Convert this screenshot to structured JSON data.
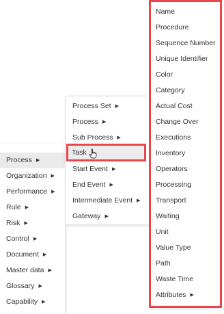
{
  "left_menu": {
    "items": [
      {
        "label": "Process",
        "has_submenu": true,
        "active": true
      },
      {
        "label": "Organization",
        "has_submenu": true
      },
      {
        "label": "Performance",
        "has_submenu": true
      },
      {
        "label": "Rule",
        "has_submenu": true
      },
      {
        "label": "Risk",
        "has_submenu": true
      },
      {
        "label": "Control",
        "has_submenu": true
      },
      {
        "label": "Document",
        "has_submenu": true
      },
      {
        "label": "Master data",
        "has_submenu": true
      },
      {
        "label": "Glossary",
        "has_submenu": true
      },
      {
        "label": "Capability",
        "has_submenu": true
      }
    ]
  },
  "middle_menu": {
    "items": [
      {
        "label": "Process Set",
        "has_submenu": true
      },
      {
        "label": "Process",
        "has_submenu": true
      },
      {
        "label": "Sub Process",
        "has_submenu": true
      },
      {
        "label": "Task",
        "has_submenu": false,
        "highlighted": true
      },
      {
        "label": "Start Event",
        "has_submenu": true
      },
      {
        "label": "End Event",
        "has_submenu": true
      },
      {
        "label": "Intermediate Event",
        "has_submenu": true
      },
      {
        "label": "Gateway",
        "has_submenu": true
      }
    ]
  },
  "right_menu": {
    "items": [
      {
        "label": "Name"
      },
      {
        "label": "Procedure"
      },
      {
        "label": "Sequence Number"
      },
      {
        "label": "Unique Identifier"
      },
      {
        "label": "Color"
      },
      {
        "label": "Category"
      },
      {
        "label": "Actual Cost"
      },
      {
        "label": "Change Over"
      },
      {
        "label": "Executions"
      },
      {
        "label": "Inventory"
      },
      {
        "label": "Operators"
      },
      {
        "label": "Processing"
      },
      {
        "label": "Transport"
      },
      {
        "label": "Waiting"
      },
      {
        "label": "Unit"
      },
      {
        "label": "Value Type"
      },
      {
        "label": "Path"
      },
      {
        "label": "Waste Time"
      },
      {
        "label": "Attributes",
        "has_submenu": true
      }
    ]
  },
  "icons": {
    "submenu_caret": "caret-right-icon",
    "cursor": "hand-pointer-icon"
  },
  "colors": {
    "highlight_border": "#e8464b",
    "active_bg": "#eaeaea",
    "text": "#333333"
  }
}
